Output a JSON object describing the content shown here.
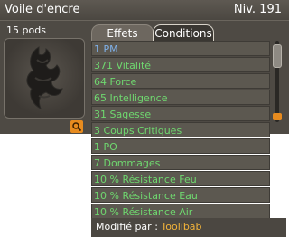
{
  "header": {
    "title": "Voile d'encre",
    "level": "Niv. 191"
  },
  "item": {
    "pods": "15 pods",
    "image_icon": "ink-veil-cape-icon",
    "zoom_icon": "magnifier-icon"
  },
  "tabs": [
    {
      "label": "Effets",
      "active": true
    },
    {
      "label": "Conditions",
      "active": false
    }
  ],
  "effects": [
    {
      "text": "1 PM",
      "color": "#7fb0e8"
    },
    {
      "text": "371 Vitalité",
      "color": "#6fd86f"
    },
    {
      "text": "64 Force",
      "color": "#6fd86f"
    },
    {
      "text": "65 Intelligence",
      "color": "#6fd86f"
    },
    {
      "text": "31 Sagesse",
      "color": "#6fd86f"
    },
    {
      "text": "3 Coups Critiques",
      "color": "#6fd86f"
    },
    {
      "text": "1 PO",
      "color": "#6fd86f"
    },
    {
      "text": "7 Dommages",
      "color": "#6fd86f"
    },
    {
      "text": "10 % Résistance Feu",
      "color": "#6fd86f"
    },
    {
      "text": "10 % Résistance Eau",
      "color": "#6fd86f"
    },
    {
      "text": "10 % Résistance Air",
      "color": "#6fd86f"
    }
  ],
  "modifier": {
    "label": "Modifié par : ",
    "name": "Toolibab"
  },
  "colors": {
    "panel": "#4e4a44",
    "accent": "#e78b1f",
    "effect_blue": "#7fb0e8",
    "effect_green": "#6fd86f",
    "modifier_name": "#f2b33a"
  }
}
